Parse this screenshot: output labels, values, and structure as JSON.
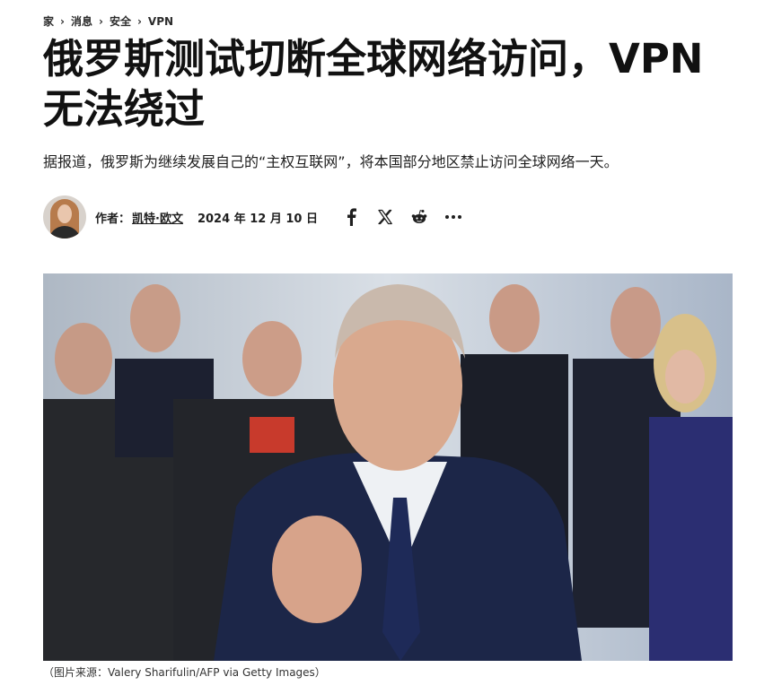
{
  "breadcrumb": {
    "items": [
      "家",
      "消息",
      "安全",
      "VPN"
    ]
  },
  "article": {
    "headline_line1": "俄罗斯测试切断全球网络访问，VPN",
    "headline_line2": "无法绕过",
    "subtitle": "据报道，俄罗斯为继续发展自己的“主权互联网”，将本国部分地区禁止访问全球网络一天。",
    "author_label": "作者：",
    "author_name": "凯特·欧文",
    "date": "2024 年 12 月 10 日",
    "image_caption": "（图片来源：Valery Sharifulin/AFP via Getty Images）"
  },
  "share_icons": [
    "facebook-icon",
    "x-icon",
    "reddit-icon",
    "more-icon"
  ],
  "colors": {
    "text": "#1f1f1f",
    "background": "#ffffff"
  }
}
